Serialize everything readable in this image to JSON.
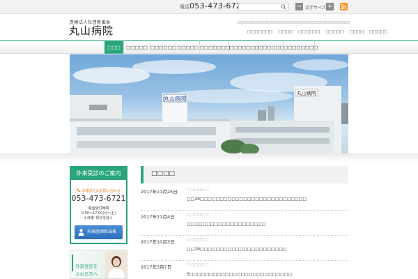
{
  "topbar": {
    "tel_label": "電話",
    "tel_number": "053-473-6721",
    "search_placeholder": "",
    "font_size_label": "文字サイズ",
    "font_minus": "−",
    "font_plus": "+"
  },
  "header": {
    "org_name": "医療法人社団新風会",
    "hospital_name": "丸山病院",
    "tagline": "□□□□□□□□□□□□□□□□□□□□□□□□□□□□□□□□□□□□□□□□□□□□",
    "util_links": [
      "□□□□□□□",
      "□□□□",
      "□□□□□□",
      "□□□□□",
      "□□□□",
      "□□□□□"
    ]
  },
  "nav": {
    "items": [
      {
        "label": "□□□",
        "active": true
      },
      {
        "label": "□□□□□"
      },
      {
        "label": "□□□□□□"
      },
      {
        "label": "□□□□□"
      },
      {
        "label": "□□□□□□□"
      },
      {
        "label": "□□□□□□□"
      },
      {
        "label": "□□□□□□"
      },
      {
        "label": "□□□□□□□□"
      }
    ]
  },
  "hero": {
    "sign_text": "丸山病院"
  },
  "sidebar": {
    "box_title": "外来受診のご案内",
    "inquiry_text": "お電話でのお問い合わせ",
    "phone": "053-473-6721",
    "hours_label": "電話受付時間",
    "hours": "9:00～17:00(月～土)",
    "closed": "※日曜･祝日を除く",
    "doctor_button": "外来医師担当表",
    "banner_line1": "外来受診を",
    "banner_line2": "される方へ"
  },
  "news": {
    "heading": "□□□□",
    "items": [
      {
        "date": "2017年11月25日",
        "category": "□ □□□□ □",
        "text": "□□29□□□□□□□□□□□□□□□□□□□□□□□□□□□"
      },
      {
        "date": "2017年11月4日",
        "category": "□ □□□□ □",
        "text": "□□□□□□□□□□□□□□□□□□□□"
      },
      {
        "date": "2017年10月3日",
        "category": "□ □□□□ □",
        "text": "□□29□□□□□□□□□□□□□□□□□□□□□□"
      },
      {
        "date": "2017年3月7日",
        "category": "□ □□□□ □",
        "text": "3□□□□□□□□□□□□□□□□□□□□□□□□□□"
      }
    ]
  },
  "colors": {
    "accent": "#2aa57e",
    "button_blue": "#2d6fb9",
    "inquiry_orange": "#e07f1c",
    "rss_orange": "#f29a2e"
  },
  "icons": [
    "search-icon",
    "rss-icon",
    "phone-icon",
    "doctor-icon"
  ]
}
